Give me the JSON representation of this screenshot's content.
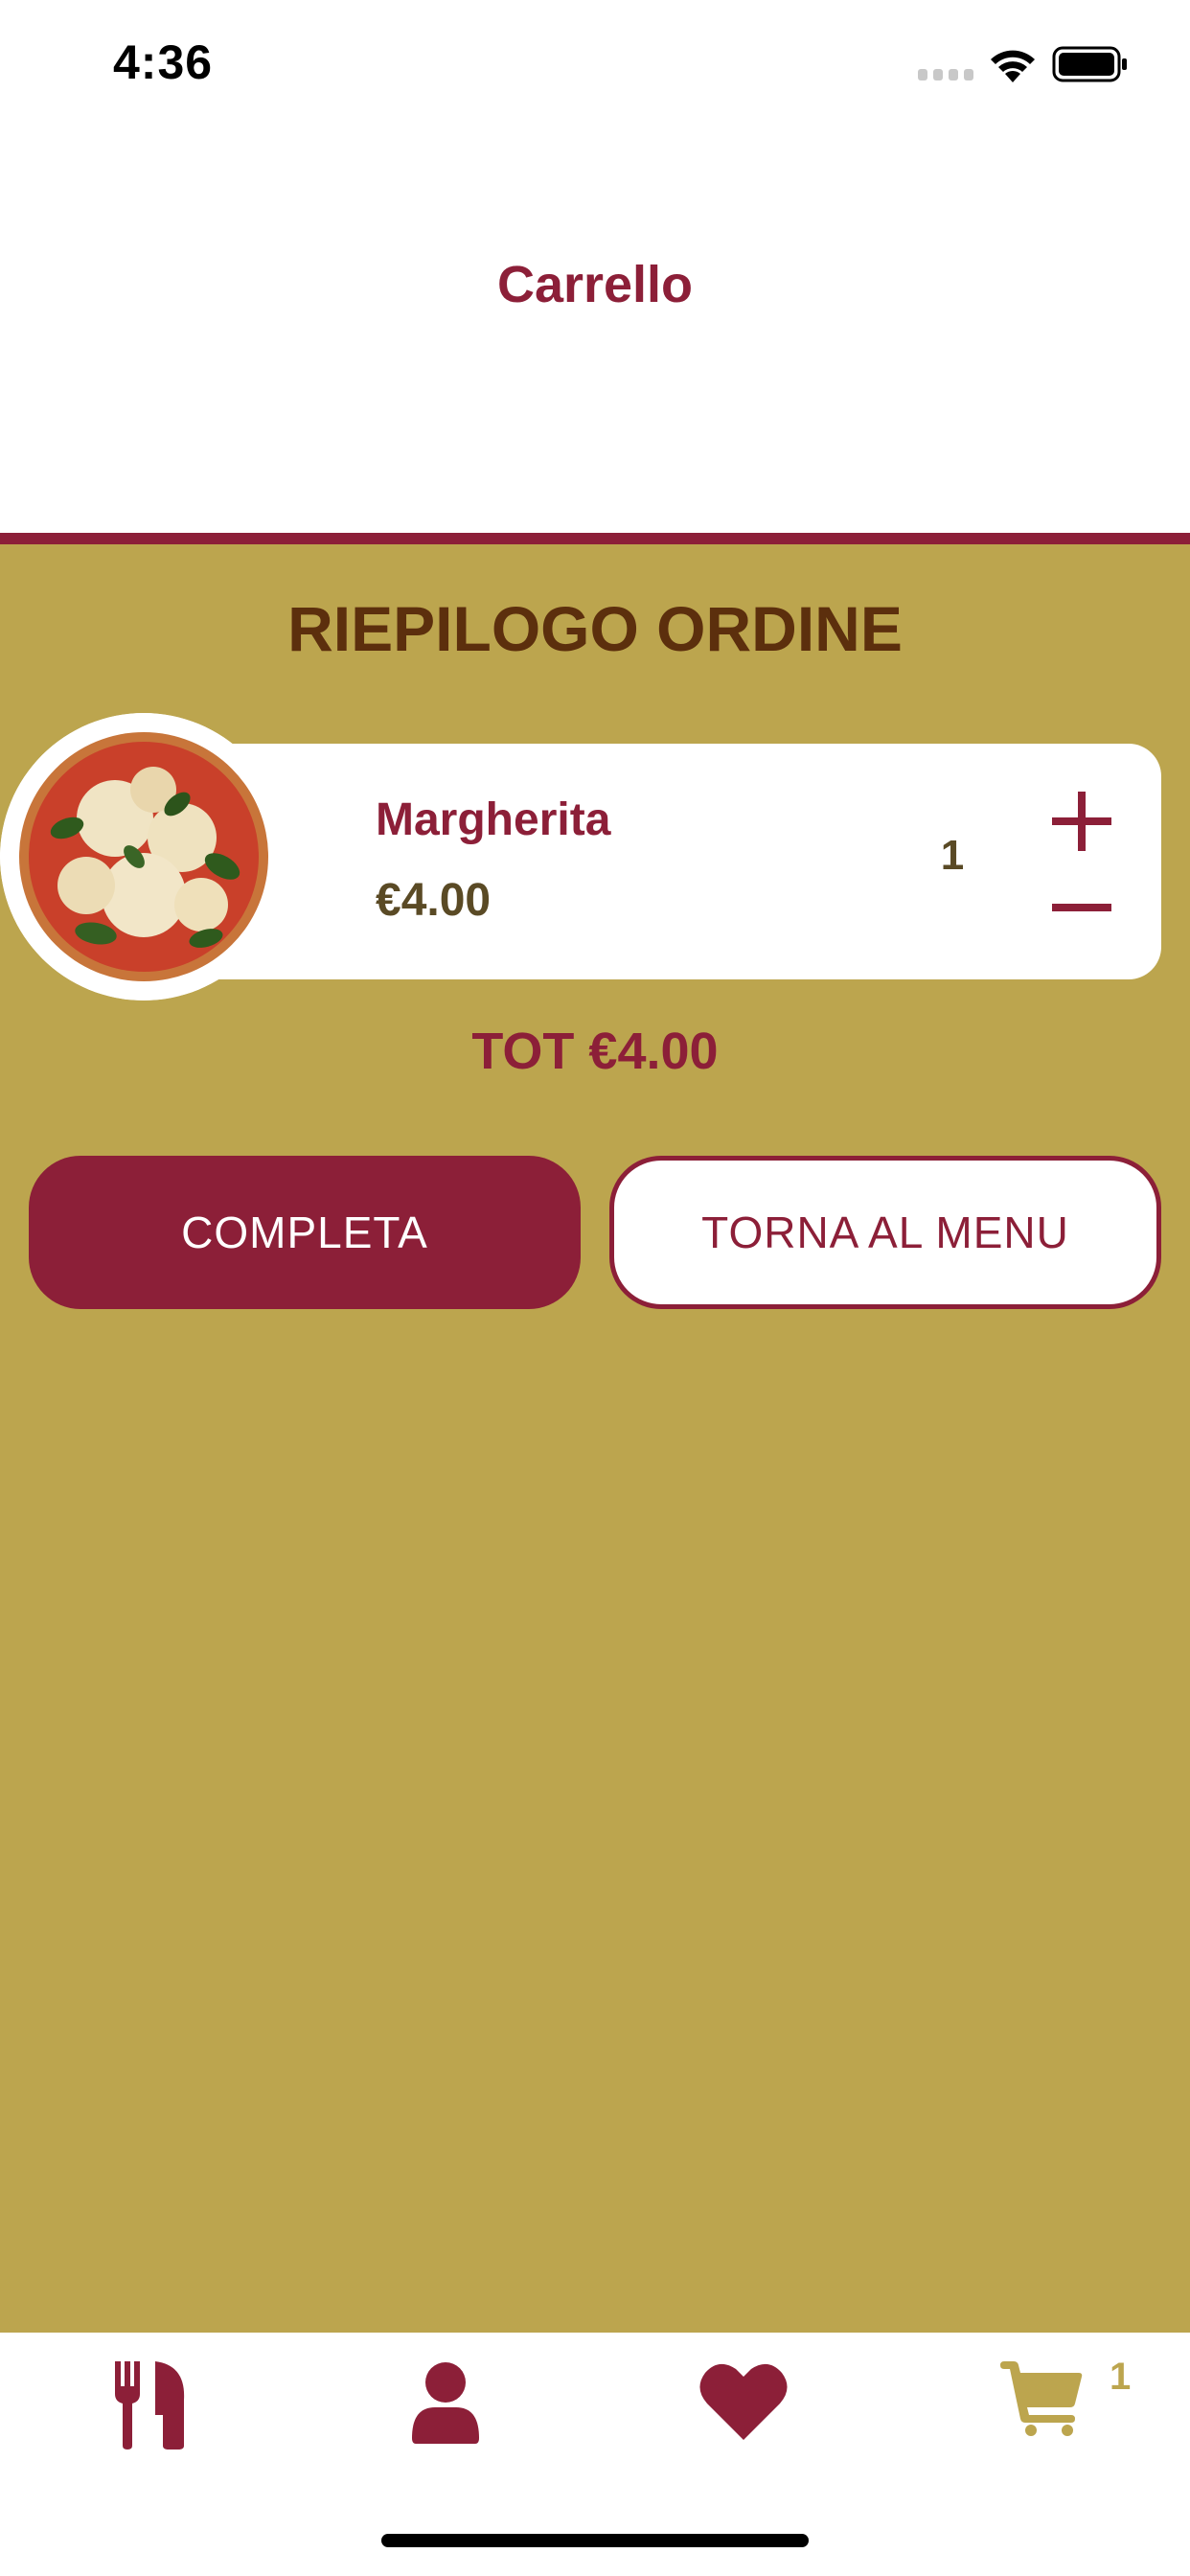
{
  "status_bar": {
    "time": "4:36"
  },
  "nav": {
    "title": "Carrello"
  },
  "summary": {
    "title": "RIEPILOGO ORDINE"
  },
  "cart_items": [
    {
      "name": "Margherita",
      "price": "€4.00",
      "quantity": "1",
      "image": "pizza-margherita-photo"
    }
  ],
  "total": "TOT €4.00",
  "buttons": {
    "complete": "COMPLETA",
    "back_to_menu": "TORNA AL MENU"
  },
  "tab_bar": {
    "tabs": [
      {
        "icon": "fork-knife-icon"
      },
      {
        "icon": "user-icon"
      },
      {
        "icon": "heart-icon"
      },
      {
        "icon": "cart-icon",
        "badge": "1"
      }
    ]
  },
  "colors": {
    "primary": "#8c1f38",
    "background": "#bca54e",
    "title_brown": "#5c2f0d",
    "text_dark": "#5a4a25"
  }
}
